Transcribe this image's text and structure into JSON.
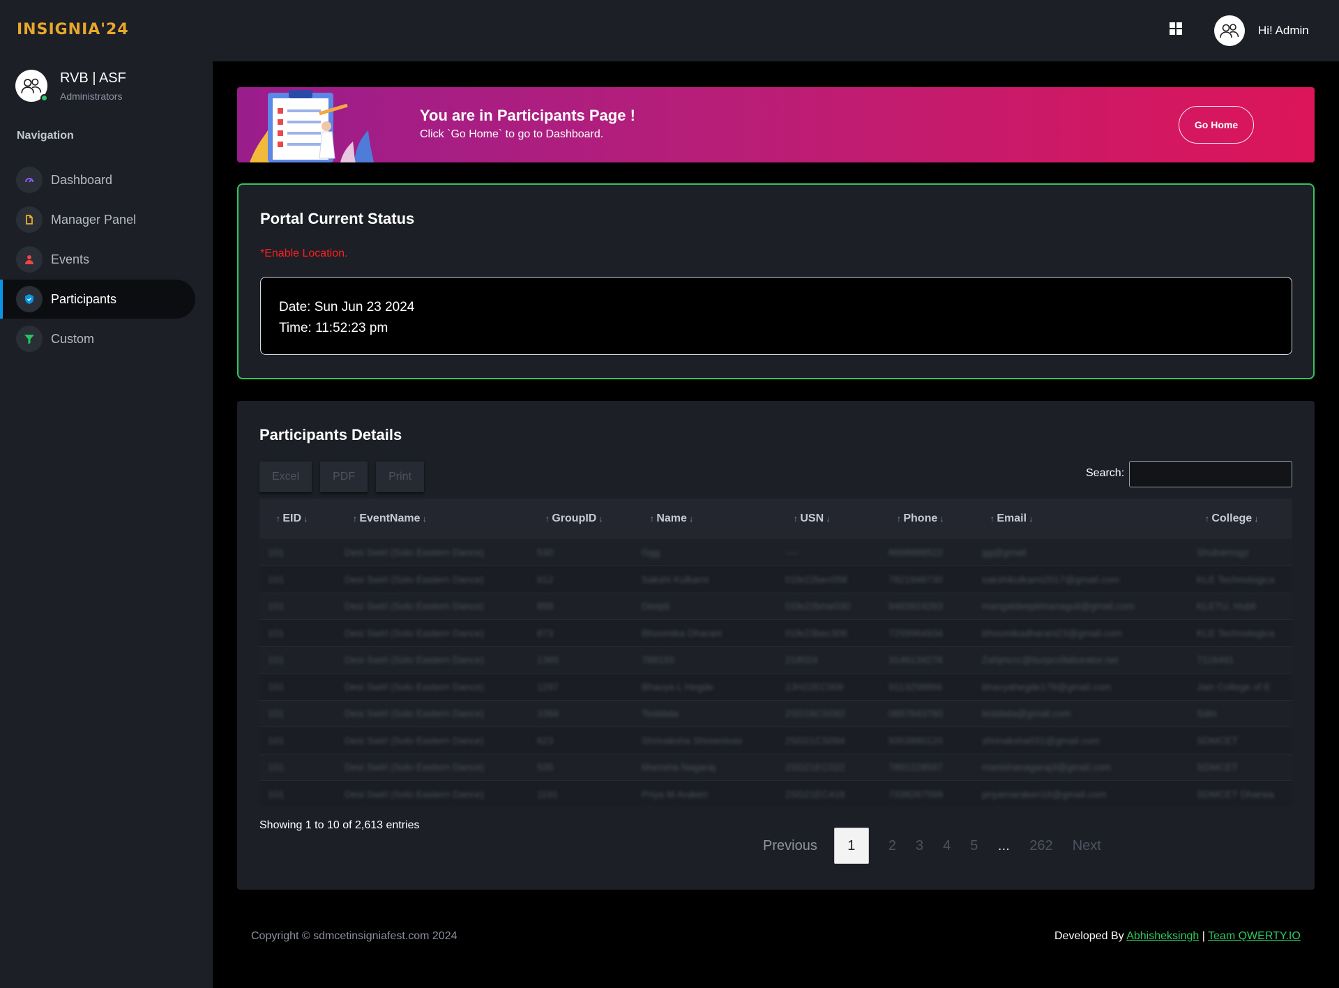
{
  "brand": {
    "logo_text": "INSIGNIA'24"
  },
  "sidebar": {
    "user": {
      "name": "RVB | ASF",
      "role": "Administrators"
    },
    "nav_heading": "Navigation",
    "items": [
      {
        "label": "Dashboard",
        "icon": "gauge-icon",
        "icon_color": "#8b5cf6"
      },
      {
        "label": "Manager Panel",
        "icon": "document-icon",
        "icon_color": "#e8b02c"
      },
      {
        "label": "Events",
        "icon": "person-icon",
        "icon_color": "#ef4444"
      },
      {
        "label": "Participants",
        "icon": "shield-icon",
        "icon_color": "#0a94e5",
        "active": true
      },
      {
        "label": "Custom",
        "icon": "filter-icon",
        "icon_color": "#22c55e"
      }
    ]
  },
  "topbar": {
    "greeting": "Hi! Admin"
  },
  "banner": {
    "title": "You are in Participants Page !",
    "subtitle": "Click `Go Home` to go to Dashboard.",
    "button": "Go Home"
  },
  "status": {
    "title": "Portal Current Status",
    "warning": "*Enable Location.",
    "date": "Date: Sun Jun 23 2024",
    "time": "Time: 11:52:23 pm"
  },
  "participants": {
    "title": "Participants Details",
    "export_buttons": [
      "Excel",
      "PDF",
      "Print"
    ],
    "search_label": "Search:",
    "columns": [
      "EID",
      "EventName",
      "GroupID",
      "Name",
      "USN",
      "Phone",
      "Email",
      "College"
    ],
    "rows": [
      [
        "101",
        "Desi Swirl (Solo Eastern Dance)",
        "530",
        "Ggg",
        "----",
        "6668888522",
        "gg@gmail",
        "Shubamogz"
      ],
      [
        "101",
        "Desi Swirl (Solo Eastern Dance)",
        "612",
        "Sakshi Kulkarni",
        "01fe22bec058",
        "7821946730",
        "sakshikulkarni2017@gmail.com",
        "KLE Technologica"
      ],
      [
        "101",
        "Desi Swirl (Solo Eastern Dance)",
        "899",
        "Deepti",
        "01fe22bme030",
        "9483924263",
        "mangaldeeptimanaguli@gmail.com",
        "KLETU, Hubli"
      ],
      [
        "101",
        "Desi Swirl (Solo Eastern Dance)",
        "673",
        "Bhoomika Dharani",
        "01fe23bec306",
        "7259964934",
        "bhoomikadharani23@gmail.com",
        "KLE Technologica"
      ],
      [
        "101",
        "Desi Swirl (Solo Eastern Dance)",
        "1365",
        "788193",
        "218024",
        "3146134276",
        "Zahjmcrc@burpcollaborator.net",
        "7116491"
      ],
      [
        "101",
        "Desi Swirl (Solo Eastern Dance)",
        "1297",
        "Bhavya L Hegde",
        "2JH22EC009",
        "9113258894",
        "bhavyahegde178@gmail.com",
        "Jain College of E"
      ],
      [
        "101",
        "Desi Swirl (Solo Eastern Dance)",
        "1084",
        "Testdata",
        "2SD16CS092",
        "0897643760",
        "testdata@gmail.com",
        "Sdm"
      ],
      [
        "101",
        "Desi Swirl (Solo Eastern Dance)",
        "623",
        "Shrinaksha Shreenivas",
        "2SD21CS094",
        "9353990120",
        "shrinaksha031@gmail.com",
        "SDMCET"
      ],
      [
        "101",
        "Desi Swirl (Solo Eastern Dance)",
        "535",
        "Manisha Nagaraj",
        "2SD21EC022",
        "7891228597",
        "manishanagaraj3@gmail.com",
        "SDMCET"
      ],
      [
        "101",
        "Desi Swirl (Solo Eastern Dance)",
        "1191",
        "Priya M Arakeri",
        "2SD21EC416",
        "7338267599",
        "priyamarakeri16@gmail.com",
        "SDMCET Dharwa"
      ]
    ],
    "info": "Showing 1 to 10 of 2,613 entries",
    "pagination": {
      "previous": "Previous",
      "pages": [
        "1",
        "2",
        "3",
        "4",
        "5"
      ],
      "ellipsis": "…",
      "last": "262",
      "next": "Next",
      "current": "1"
    }
  },
  "footer": {
    "copyright": "Copyright © sdmcetinsigniafest.com 2024",
    "developed_prefix": "Developed By",
    "dev_link1": "Abhisheksingh",
    "separator": "|",
    "dev_link2": "Team QWERTY.IO"
  }
}
